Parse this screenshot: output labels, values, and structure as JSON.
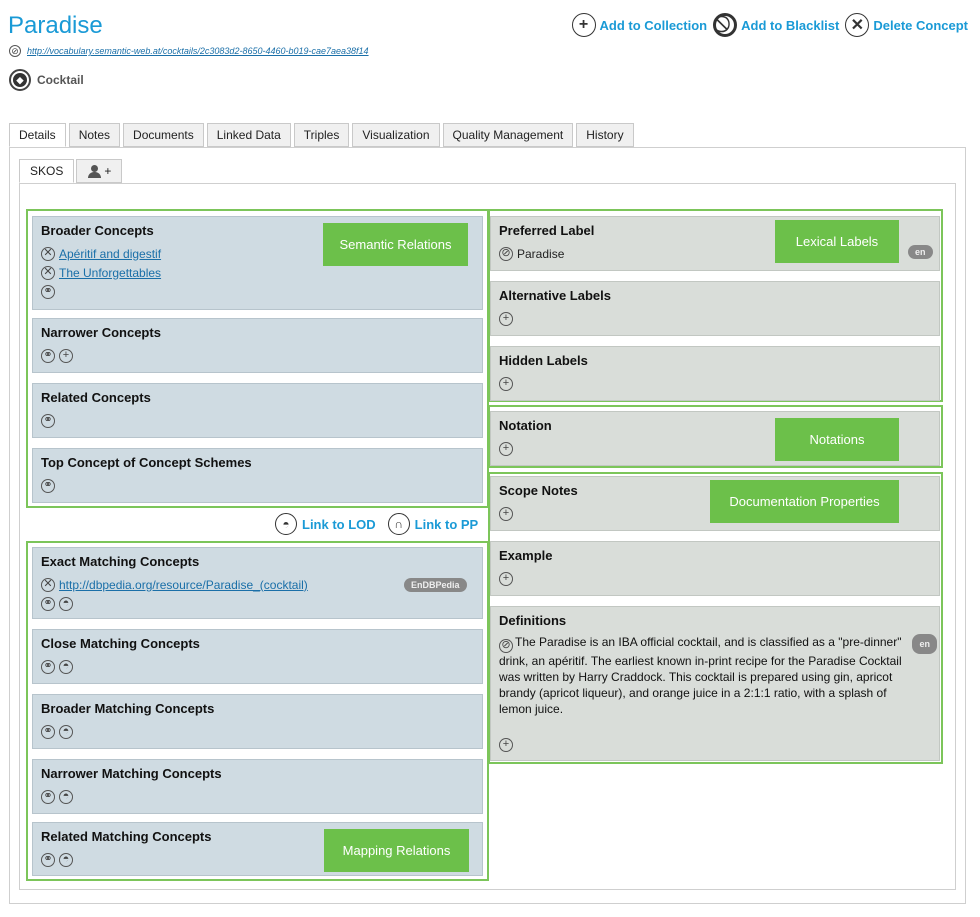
{
  "concept": {
    "title": "Paradise",
    "uri": "http://vocabulary.semantic-web.at/cocktails/2c3083d2-8650-4460-b019-cae7aea38f14",
    "type": "Cocktail"
  },
  "actions": {
    "add_collection": "Add to Collection",
    "add_blacklist": "Add to Blacklist",
    "delete": "Delete Concept"
  },
  "tabs": [
    "Details",
    "Notes",
    "Documents",
    "Linked Data",
    "Triples",
    "Visualization",
    "Quality Management",
    "History"
  ],
  "subtabs": {
    "skos": "SKOS",
    "add_label": "+"
  },
  "semantic": {
    "group_label": "Semantic Relations",
    "broader": {
      "title": "Broader Concepts",
      "items": [
        "Apéritif and digestif",
        "The Unforgettables"
      ]
    },
    "narrower": {
      "title": "Narrower Concepts"
    },
    "related": {
      "title": "Related Concepts"
    },
    "top_concept": {
      "title": "Top Concept of Concept Schemes"
    }
  },
  "links": {
    "lod": "Link to LOD",
    "pp": "Link to PP"
  },
  "mapping": {
    "group_label": "Mapping Relations",
    "exact": {
      "title": "Exact Matching Concepts",
      "item": "http://dbpedia.org/resource/Paradise_(cocktail)",
      "source": "EnDBPedia"
    },
    "close": {
      "title": "Close Matching Concepts"
    },
    "broader": {
      "title": "Broader Matching Concepts"
    },
    "narrower": {
      "title": "Narrower Matching Concepts"
    },
    "related": {
      "title": "Related Matching Concepts"
    }
  },
  "lexical": {
    "group_label": "Lexical Labels",
    "preferred": {
      "title": "Preferred Label",
      "value": "Paradise",
      "lang": "en"
    },
    "alternative": {
      "title": "Alternative Labels"
    },
    "hidden": {
      "title": "Hidden Labels"
    }
  },
  "notation": {
    "group_label": "Notations",
    "title": "Notation"
  },
  "documentation": {
    "group_label": "Documentation Properties",
    "scope": {
      "title": "Scope Notes"
    },
    "example": {
      "title": "Example"
    },
    "definitions": {
      "title": "Definitions",
      "lang": "en",
      "text": "The Paradise is an IBA official cocktail, and is classified as a \"pre-dinner\" drink, an apéritif. The earliest known in-print recipe for the Paradise Cocktail was written by Harry Craddock. This cocktail is prepared using gin, apricot brandy (apricot liqueur), and orange juice in a 2:1:1 ratio, with a splash of lemon juice."
    }
  },
  "colors": {
    "accent": "#1a9ad6",
    "group_border": "#7cc55a",
    "badge": "#6cc04a"
  }
}
